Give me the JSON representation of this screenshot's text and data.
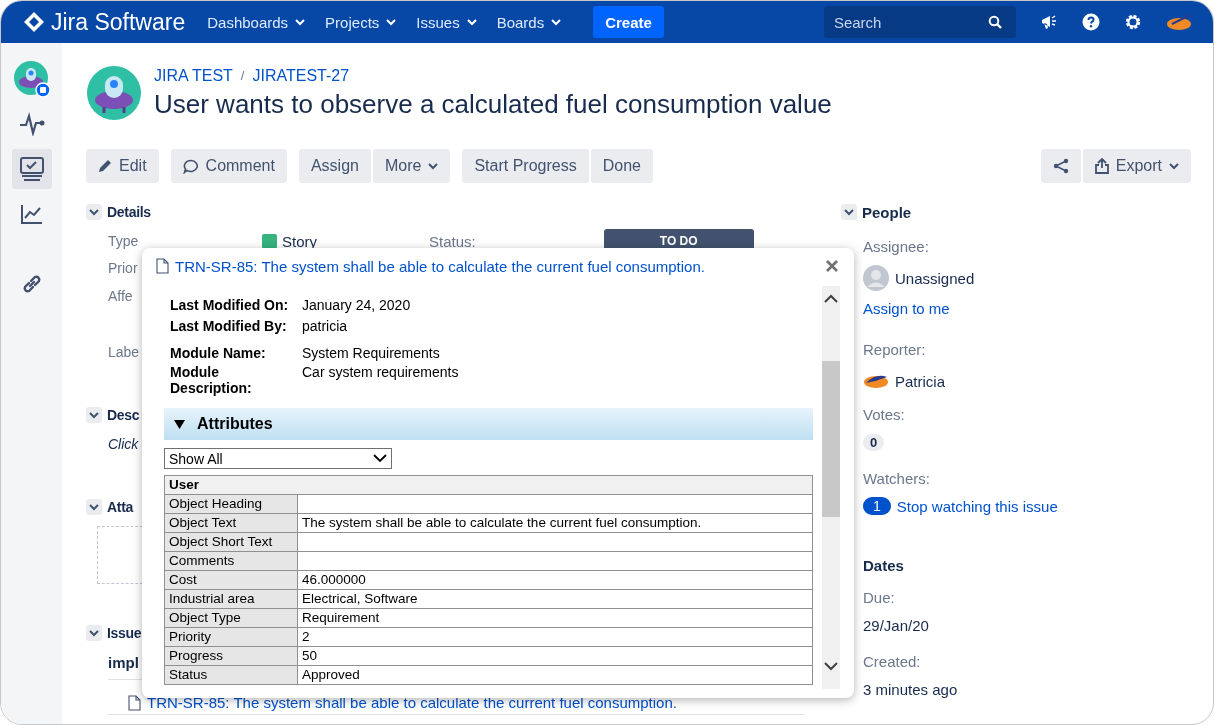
{
  "header": {
    "logo": "Jira Software",
    "menus": [
      {
        "label": "Dashboards"
      },
      {
        "label": "Projects"
      },
      {
        "label": "Issues"
      },
      {
        "label": "Boards"
      }
    ],
    "create": "Create",
    "search": {
      "placeholder": "Search"
    }
  },
  "sidebar": {
    "items": [
      {
        "selected": false
      },
      {
        "selected": false
      },
      {
        "selected": true
      },
      {
        "selected": false
      },
      {
        "selected": false
      }
    ]
  },
  "issue": {
    "breadcrumbs": [
      "JIRA TEST",
      "JIRATEST-27"
    ],
    "breadcrumb_separator": "/",
    "title": "User wants to observe a calculated fuel consumption value"
  },
  "toolbar": {
    "groups": [
      [
        {
          "label": "Edit",
          "kind": "edit"
        }
      ],
      [
        {
          "label": "Comment",
          "kind": "comment"
        }
      ],
      [
        {
          "label": "Assign",
          "kind": "plain"
        },
        {
          "label": "More",
          "kind": "menu"
        }
      ],
      [
        {
          "label": "Start Progress",
          "kind": "plain"
        },
        {
          "label": "Done",
          "kind": "plain"
        }
      ]
    ],
    "export": "Export"
  },
  "sections": [
    {
      "heading": "Details",
      "expanded": true,
      "lines": [
        "Type",
        "Prior",
        "Affe",
        "Labe"
      ]
    },
    {
      "heading": "Desc",
      "expanded": true,
      "lines": [
        "Click"
      ],
      "italic": true
    },
    {
      "heading": "Atta",
      "expanded": true,
      "dropzone": true
    },
    {
      "heading": "Issue",
      "expanded": true,
      "lines": [
        "impl"
      ],
      "bold": true
    }
  ],
  "details_cut": {
    "type_value": "Story",
    "status_label": "Status:",
    "status_value": "TO DO"
  },
  "issue_link": "TRN-SR-85: The system shall be able to calculate the current fuel consumption.",
  "people": {
    "heading": "People",
    "expanded": true,
    "assignee_label": "Assignee:",
    "assignee": "Unassigned",
    "assign_to_me": "Assign to me",
    "reporter_label": "Reporter:",
    "reporter": "Patricia",
    "votes_label": "Votes:",
    "votes": "0",
    "watchers_label": "Watchers:",
    "watchers": "1",
    "watch_link": "Stop watching this issue"
  },
  "dates": {
    "heading": "Dates",
    "due_label": "Due:",
    "due": "29/Jan/20",
    "created_label": "Created:",
    "created": "3 minutes ago"
  },
  "popup": {
    "title": "TRN-SR-85: The system shall be able to calculate the current fuel consumption.",
    "meta": [
      {
        "label": "Last Modified On:",
        "value": "January 24, 2020"
      },
      {
        "label": "Last Modified By:",
        "value": "patricia"
      },
      {
        "label": "Module Name:",
        "value": "System Requirements"
      },
      {
        "label": "Module Description:",
        "value": "Car system requirements"
      }
    ],
    "attributes": {
      "heading": "Attributes",
      "expanded": true,
      "filter": "Show All",
      "table_heading": "User",
      "rows": [
        [
          "Object Heading",
          ""
        ],
        [
          "Object Text",
          "The system shall be able to calculate the current fuel consumption."
        ],
        [
          "Object Short Text",
          ""
        ],
        [
          "Comments",
          ""
        ],
        [
          "Cost",
          "46.000000"
        ],
        [
          "Industrial area",
          "Electrical, Software"
        ],
        [
          "Object Type",
          "Requirement"
        ],
        [
          "Priority",
          "2"
        ],
        [
          "Progress",
          "50"
        ],
        [
          "Status",
          "Approved"
        ]
      ]
    }
  }
}
